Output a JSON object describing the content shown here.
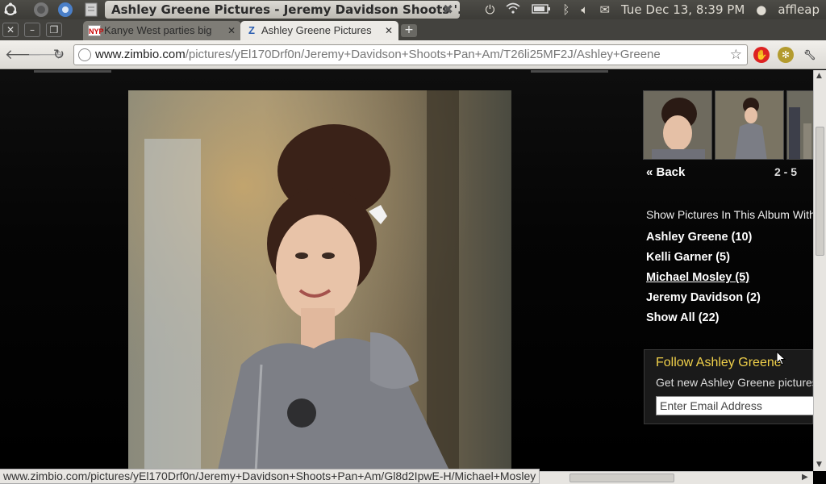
{
  "panel": {
    "window_title": "Ashley Greene Pictures - Jeremy Davidson Shoots '...",
    "clock": "Tue Dec 13,  8:39 PM",
    "user": "affleap",
    "icons": [
      "ubuntu-logo-icon",
      "firefox-icon",
      "chromium-icon",
      "text-editor-icon",
      "close-icon",
      "power-icon",
      "wifi-icon",
      "battery-icon",
      "bluetooth-icon",
      "volume-icon",
      "mail-icon",
      "user-icon"
    ]
  },
  "tabs": [
    {
      "label": "Kanye West parties big",
      "favicon": "NYP"
    },
    {
      "label": "Ashley Greene Pictures",
      "favicon": "Z"
    }
  ],
  "omnibox": {
    "host": "www.zimbio.com",
    "path": "/pictures/yEl170Drf0n/Jeremy+Davidson+Shoots+Pan+Am/T26li25MF2J/Ashley+Greene"
  },
  "sidebar": {
    "back_label": "« Back",
    "range": "2 - 5",
    "album_heading": "Show Pictures In This Album With",
    "people": [
      "Ashley Greene (10)",
      "Kelli Garner (5)",
      "Michael Mosley (5)",
      "Jeremy Davidson (2)",
      "Show All (22)"
    ],
    "hovered_index": 2
  },
  "follow": {
    "title": "Follow Ashley Greene",
    "subtitle": "Get new Ashley Greene pictures",
    "email_placeholder": "Enter Email Address"
  },
  "status_url": "www.zimbio.com/pictures/yEl170Drf0n/Jeremy+Davidson+Shoots+Pan+Am/Gl8d2IpwE-H/Michael+Mosley",
  "colors": {
    "panel_bg": "#3c3b37",
    "follow_title": "#f0d04a",
    "page_bg": "#000000"
  }
}
